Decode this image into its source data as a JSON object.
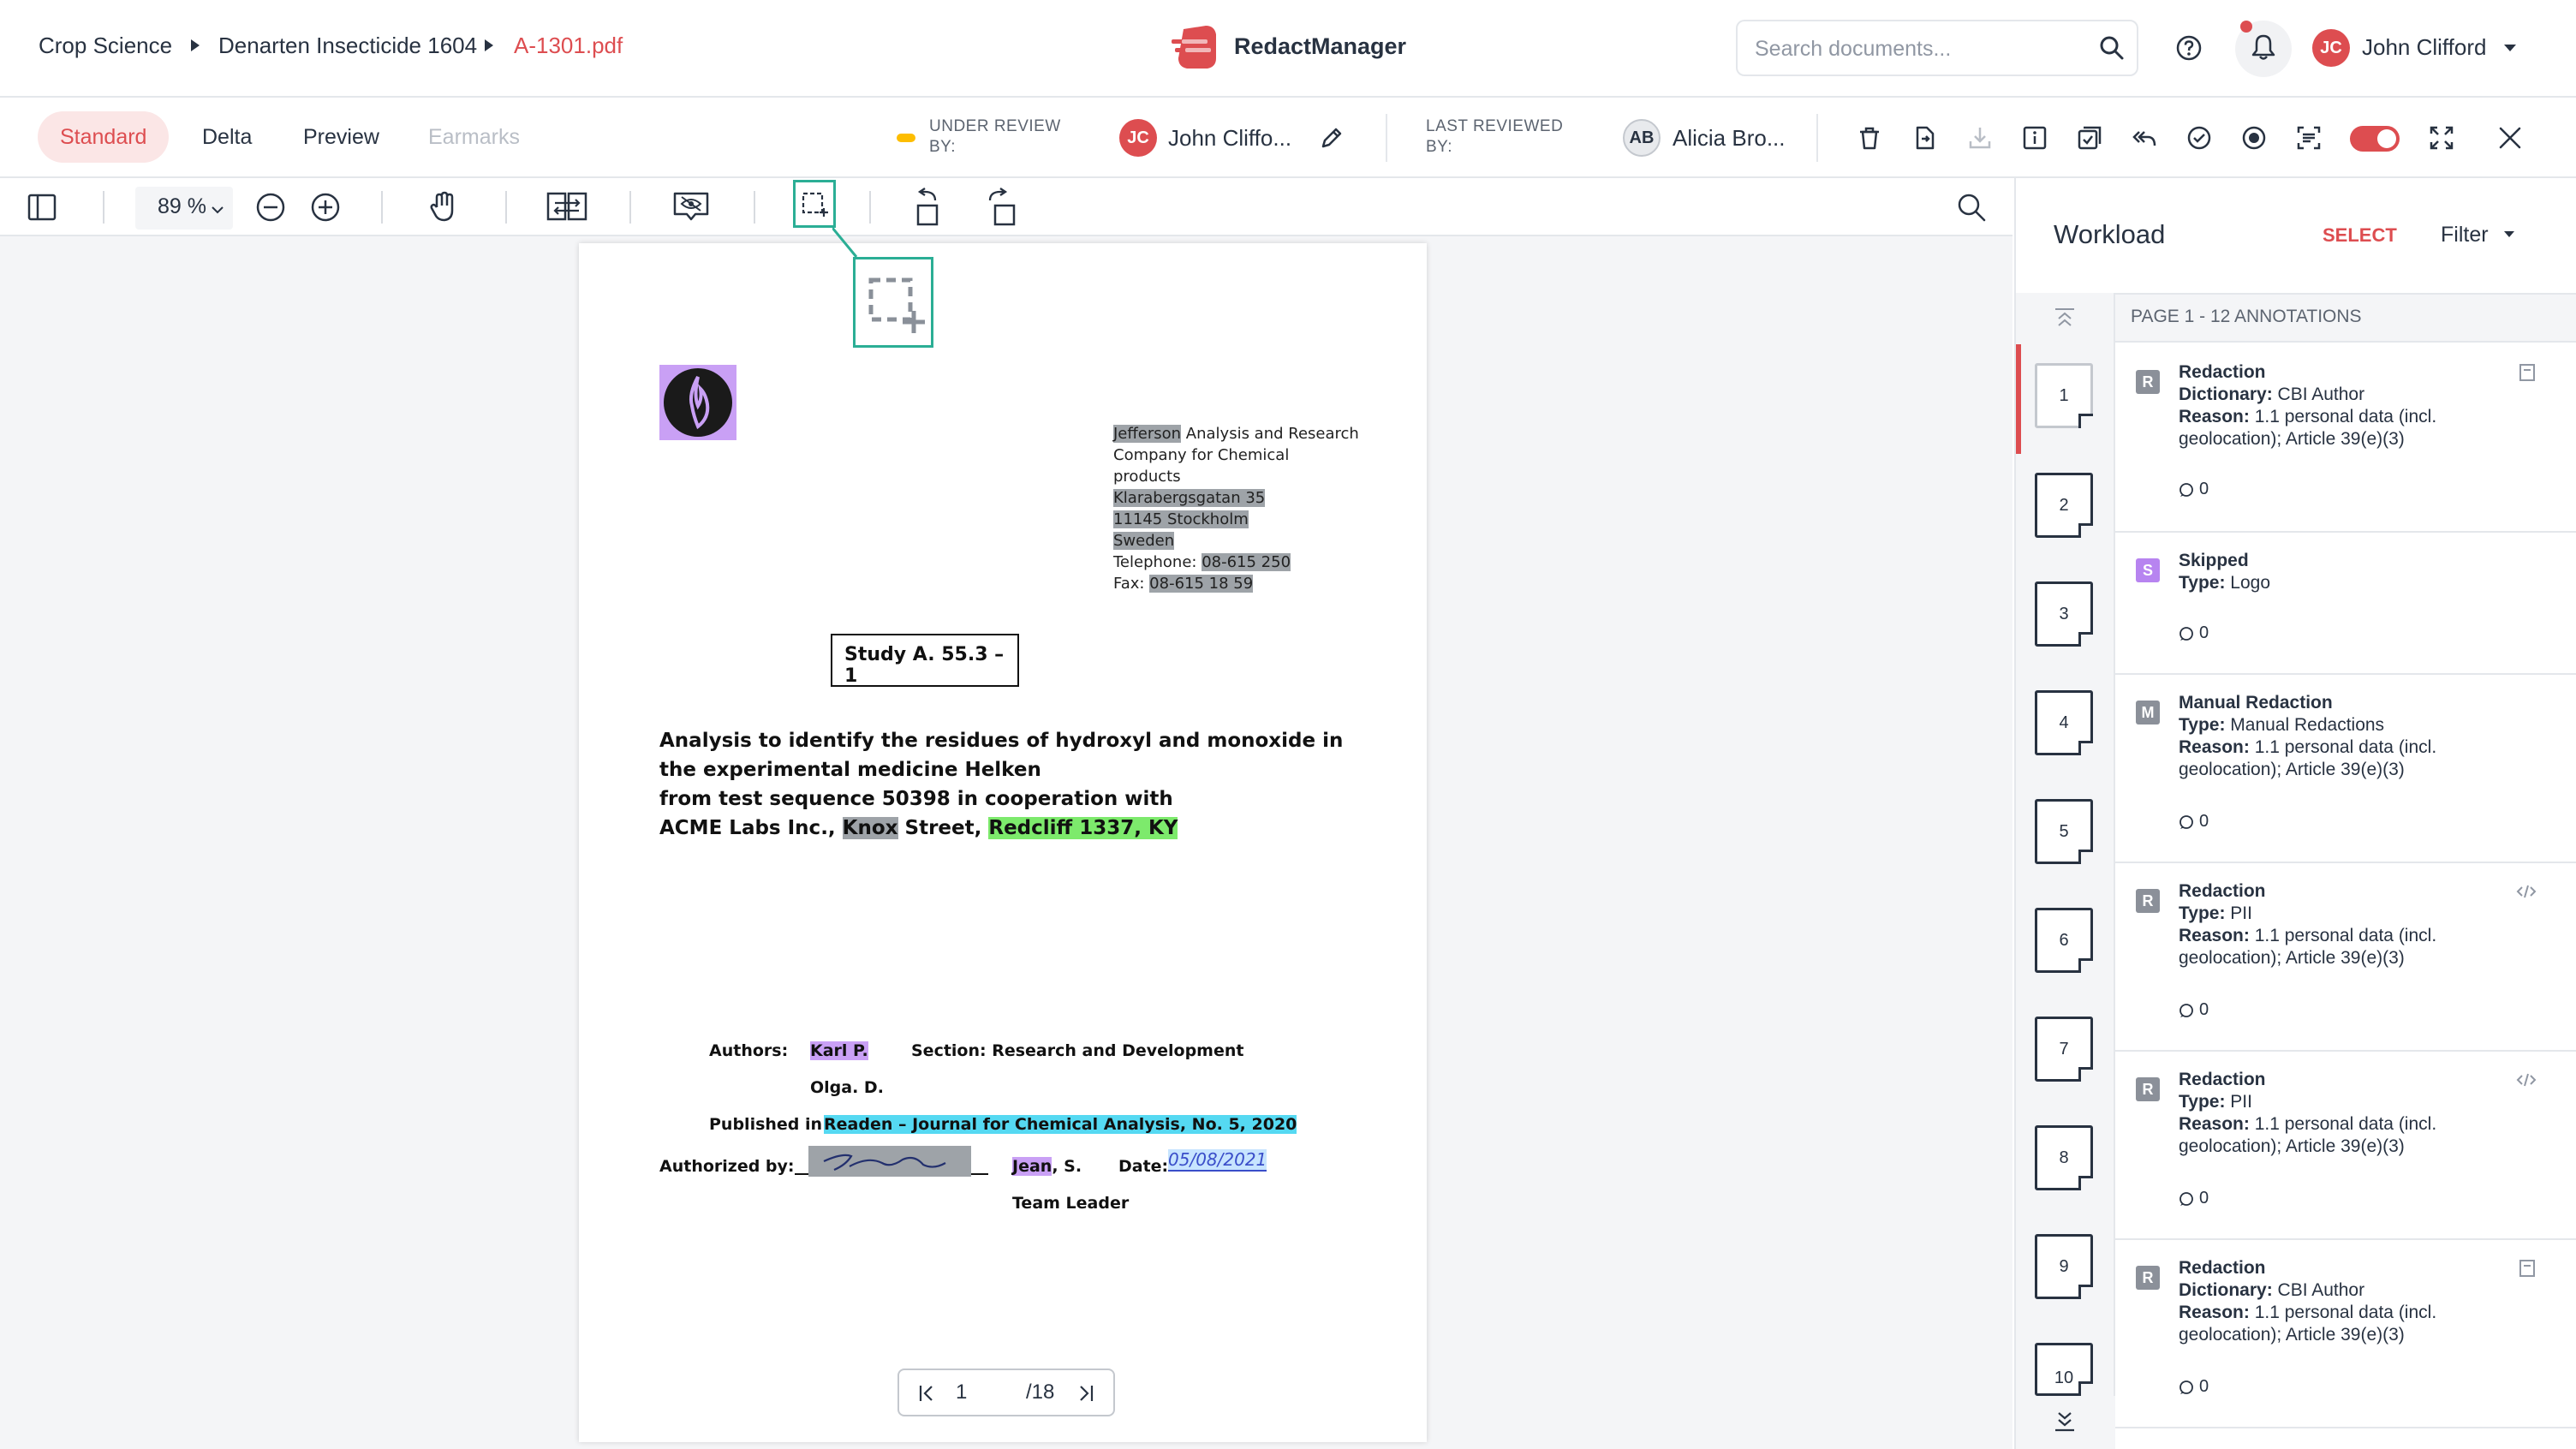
{
  "breadcrumb": {
    "items": [
      "Crop Science",
      "Denarten Insecticide 1604",
      "A-1301.pdf"
    ]
  },
  "brand": {
    "name": "RedactManager",
    "accent": "#dd4d50"
  },
  "search": {
    "placeholder": "Search documents..."
  },
  "user": {
    "initials": "JC",
    "name": "John Clifford"
  },
  "view_tabs": [
    {
      "label": "Standard",
      "state": "active"
    },
    {
      "label": "Delta",
      "state": "normal"
    },
    {
      "label": "Preview",
      "state": "normal"
    },
    {
      "label": "Earmarks",
      "state": "disabled"
    }
  ],
  "review": {
    "status_label_1": "UNDER REVIEW",
    "status_label_2": "BY:",
    "reviewer_initials": "JC",
    "reviewer_name": "John Cliffo...",
    "last_label_1": "LAST REVIEWED",
    "last_label_2": "BY:",
    "last_initials": "AB",
    "last_name": "Alicia Bro..."
  },
  "toolbar": {
    "zoom": "89 %"
  },
  "document": {
    "address": {
      "company_first": "Jefferson",
      "company_rest": " Analysis and Research",
      "line2": "Company for Chemical",
      "line3": "products",
      "street": "Klarabergsgatan 35",
      "city": "11145 Stockholm",
      "country": "Sweden",
      "tel_label": "Telephone: ",
      "tel": "08-615 250",
      "fax_label": "Fax: ",
      "fax": "08-615 18 59"
    },
    "study": "Study A. 55.3 – 1",
    "title_l1": "Analysis to identify the residues of hydroxyl and monoxide in",
    "title_l2": "the experimental medicine Helken",
    "title_l3": "from test sequence 50398 in cooperation with",
    "title_l4a": "ACME Labs Inc., ",
    "title_l4b": "Knox",
    "title_l4c": " Street, ",
    "title_l4d": "Redcliff 1337, KY",
    "authors_label": "Authors:",
    "author1": "Karl P.",
    "author2": "Olga. D.",
    "section": "Section: Research and Development",
    "published_label": "Published in:",
    "published": "Readen – Journal for Chemical Analysis, No. 5, 2020",
    "authorized_label": "Authorized by:",
    "signer_first": "Jean",
    "signer_rest": ", S.",
    "signer_role": "Team Leader",
    "date_label": "Date:",
    "date": "05/08/2021"
  },
  "pager": {
    "current": "1",
    "total": "/18"
  },
  "workload": {
    "title": "Workload",
    "select": "SELECT",
    "filter": "Filter",
    "page_header": "PAGE 1 - 12 ANNOTATIONS"
  },
  "thumbnails": [
    "1",
    "2",
    "3",
    "4",
    "5",
    "6",
    "7",
    "8",
    "9",
    "10"
  ],
  "annotations": [
    {
      "badge": "R",
      "color": "#8b9099",
      "title": "Redaction",
      "k1": "Dictionary:",
      "v1": " CBI Author",
      "k2": "Reason:",
      "v2": " 1.1 personal data (incl. geolocation); Article 39(e)(3)",
      "comments": "0"
    },
    {
      "badge": "S",
      "color": "#b784f0",
      "title": "Skipped",
      "k1": "Type:",
      "v1": " Logo",
      "k2": "",
      "v2": "",
      "comments": "0"
    },
    {
      "badge": "M",
      "color": "#8b9099",
      "title": "Manual Redaction",
      "k1": "Type:",
      "v1": " Manual Redactions",
      "k2": "Reason:",
      "v2": " 1.1 personal data (incl. geolocation); Article 39(e)(3)",
      "comments": "0"
    },
    {
      "badge": "R",
      "color": "#8b9099",
      "title": "Redaction",
      "k1": "Type:",
      "v1": " PII",
      "k2": "Reason:",
      "v2": " 1.1 personal data (incl. geolocation); Article 39(e)(3)",
      "comments": "0"
    },
    {
      "badge": "R",
      "color": "#8b9099",
      "title": "Redaction",
      "k1": "Type:",
      "v1": " PII",
      "k2": "Reason:",
      "v2": " 1.1 personal data (incl. geolocation); Article 39(e)(3)",
      "comments": "0"
    },
    {
      "badge": "R",
      "color": "#8b9099",
      "title": "Redaction",
      "k1": "Dictionary:",
      "v1": " CBI Author",
      "k2": "Reason:",
      "v2": " 1.1 personal data (incl. geolocation); Article 39(e)(3)",
      "comments": "0"
    }
  ]
}
